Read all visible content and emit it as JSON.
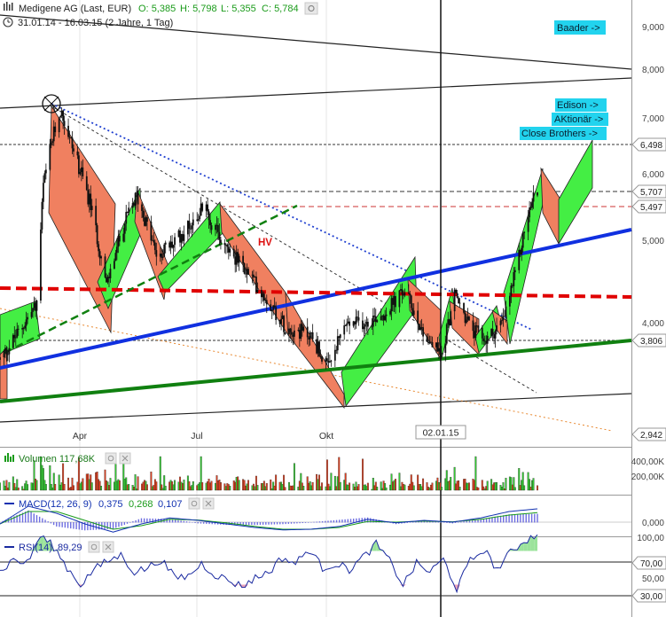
{
  "header": {
    "symbol": "Medigene AG (Last, EUR)",
    "ohlc": [
      {
        "label": "O:",
        "value": "5,385"
      },
      {
        "label": "H:",
        "value": "5,798"
      },
      {
        "label": "L:",
        "value": "5,355"
      },
      {
        "label": "C:",
        "value": "5,784"
      }
    ],
    "range": "31.01.14 - 16.03.15 (2 Jahre, 1 Tag)"
  },
  "colors": {
    "up": "#33cc33",
    "down": "#e04020",
    "channel_up": "#44ee44",
    "channel_down": "#f08060",
    "blue_trend": "#1030e0",
    "green_trend": "#108010",
    "red_dash": "#e00000",
    "label_bg": "#22d3ee"
  },
  "chart_data": [
    {
      "type": "line",
      "panel": "price",
      "title": "Medigene AG (Last, EUR)",
      "x_ticks": [
        "Apr",
        "Jul",
        "Okt"
      ],
      "marker_date": "02.01.15",
      "ylim": [
        2.8,
        9.3
      ],
      "y_scale": "log",
      "y_ticks": [
        "9,000",
        "8,000",
        "7,000",
        "6,000",
        "5,000",
        "4,000"
      ],
      "price_levels": [
        "6,498",
        "5,707",
        "5,497",
        "3,806",
        "2,942"
      ],
      "close_path": [
        [
          "2014-01-31",
          3.6
        ],
        [
          "2014-02-15",
          3.9
        ],
        [
          "2014-02-28",
          4.2
        ],
        [
          "2014-03-05",
          5.8
        ],
        [
          "2014-03-12",
          6.6
        ],
        [
          "2014-03-18",
          7.15
        ],
        [
          "2014-03-28",
          6.4
        ],
        [
          "2014-04-10",
          5.5
        ],
        [
          "2014-04-22",
          4.4
        ],
        [
          "2014-05-05",
          5.2
        ],
        [
          "2014-05-15",
          5.65
        ],
        [
          "2014-05-30",
          4.8
        ],
        [
          "2014-06-12",
          4.95
        ],
        [
          "2014-06-26",
          5.25
        ],
        [
          "2014-07-05",
          5.5
        ],
        [
          "2014-07-15",
          5.1
        ],
        [
          "2014-08-01",
          4.7
        ],
        [
          "2014-08-20",
          4.3
        ],
        [
          "2014-09-05",
          3.95
        ],
        [
          "2014-09-25",
          3.85
        ],
        [
          "2014-10-08",
          3.5
        ],
        [
          "2014-10-20",
          3.95
        ],
        [
          "2014-11-05",
          4.0
        ],
        [
          "2014-11-20",
          4.1
        ],
        [
          "2014-12-05",
          4.35
        ],
        [
          "2014-12-20",
          3.85
        ],
        [
          "2015-01-02",
          3.65
        ],
        [
          "2015-01-12",
          4.3
        ],
        [
          "2015-01-25",
          3.9
        ],
        [
          "2015-02-05",
          3.8
        ],
        [
          "2015-02-18",
          4.0
        ],
        [
          "2015-02-28",
          4.6
        ],
        [
          "2015-03-08",
          5.3
        ],
        [
          "2015-03-16",
          5.784
        ]
      ],
      "annotations": [
        "Baader ->",
        "Edison ->",
        "AKtionär ->",
        "Close Brothers ->",
        "HV"
      ]
    },
    {
      "type": "bar",
      "panel": "volume",
      "title": "Volumen",
      "latest": "117,68K",
      "y_ticks": [
        "400,00K",
        "200,00K"
      ]
    },
    {
      "type": "line",
      "panel": "macd",
      "title": "MACD(12, 26, 9)",
      "values": [
        "0,375",
        "0,268",
        "0,107"
      ],
      "y_ticks": [
        "0,000"
      ],
      "macd_path": [
        -0.05,
        0.45,
        0.25,
        -0.05,
        -0.28,
        -0.05,
        0.12,
        0.05,
        -0.05,
        -0.15,
        -0.22,
        -0.2,
        -0.12,
        0.08,
        -0.02,
        0.05,
        0.0,
        0.12,
        0.3,
        0.375
      ],
      "signal_path": [
        -0.05,
        0.3,
        0.3,
        0.05,
        -0.2,
        -0.1,
        0.08,
        0.06,
        -0.02,
        -0.12,
        -0.2,
        -0.2,
        -0.15,
        0.02,
        0.0,
        0.03,
        0.01,
        0.08,
        0.2,
        0.268
      ]
    },
    {
      "type": "line",
      "panel": "rsi",
      "title": "RSI(14)",
      "value": "89,29",
      "ylim": [
        0,
        100
      ],
      "y_ticks": [
        "100,00",
        "70,00",
        "50,00",
        "30,00"
      ],
      "levels": [
        70,
        30
      ],
      "rsi_path": [
        45,
        60,
        55,
        88,
        75,
        50,
        30,
        48,
        58,
        65,
        45,
        50,
        60,
        38,
        40,
        55,
        42,
        35,
        28,
        38,
        45,
        62,
        55,
        72,
        50,
        55,
        48,
        62,
        78,
        58,
        30,
        55,
        45,
        60,
        25,
        58,
        72,
        48,
        68,
        82,
        89.29
      ]
    }
  ]
}
